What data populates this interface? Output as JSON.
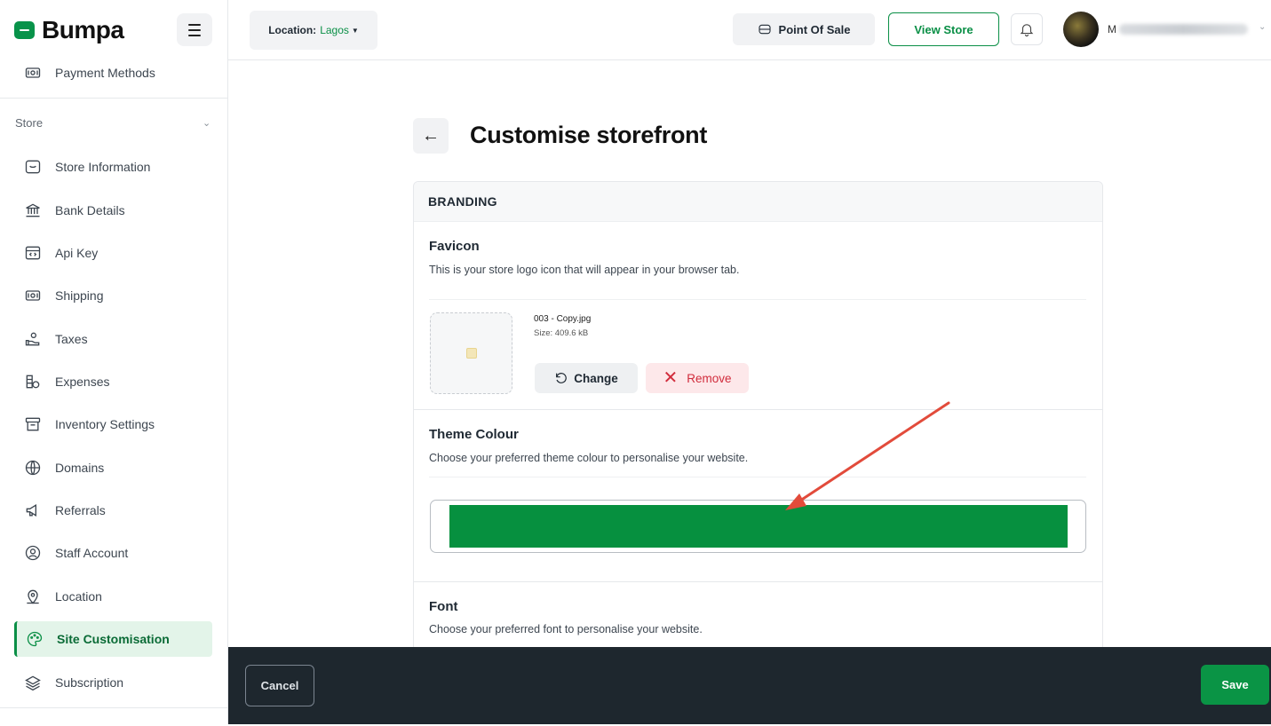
{
  "brand": {
    "name": "Bumpa",
    "color": "#08934a"
  },
  "sidebar": {
    "top_item": {
      "label": "Payment Methods",
      "icon": "cash-icon"
    },
    "section_label": "Store",
    "items": [
      {
        "label": "Store Information",
        "icon": "storefront-icon",
        "active": false
      },
      {
        "label": "Bank Details",
        "icon": "bank-icon",
        "active": false
      },
      {
        "label": "Api Key",
        "icon": "code-icon",
        "active": false
      },
      {
        "label": "Shipping",
        "icon": "cash-icon",
        "active": false
      },
      {
        "label": "Taxes",
        "icon": "hand-coins-icon",
        "active": false
      },
      {
        "label": "Expenses",
        "icon": "coins-icon",
        "active": false
      },
      {
        "label": "Inventory Settings",
        "icon": "archive-box-icon",
        "active": false
      },
      {
        "label": "Domains",
        "icon": "globe-icon",
        "active": false
      },
      {
        "label": "Referrals",
        "icon": "megaphone-icon",
        "active": false
      },
      {
        "label": "Staff Account",
        "icon": "user-circle-icon",
        "active": false
      },
      {
        "label": "Location",
        "icon": "location-user-icon",
        "active": false
      },
      {
        "label": "Site Customisation",
        "icon": "palette-icon",
        "active": true
      },
      {
        "label": "Subscription",
        "icon": "layers-icon",
        "active": false
      }
    ]
  },
  "topbar": {
    "location_label": "Location:",
    "location_value": "Lagos",
    "pos_label": "Point Of Sale",
    "view_store_label": "View Store",
    "user_initial": "M"
  },
  "page": {
    "title": "Customise storefront",
    "section_header": "BRANDING",
    "favicon": {
      "title": "Favicon",
      "description": "This is your store logo icon that will appear in your browser tab.",
      "file_name": "003 - Copy.jpg",
      "file_size": "Size: 409.6 kB",
      "change_label": "Change",
      "remove_label": "Remove"
    },
    "theme": {
      "title": "Theme Colour",
      "description": "Choose your preferred theme colour to personalise your website.",
      "color": "#06903f"
    },
    "font": {
      "title": "Font",
      "description": "Choose your preferred font to personalise your website."
    }
  },
  "footer": {
    "cancel_label": "Cancel",
    "save_label": "Save"
  },
  "colors": {
    "accent": "#0a8f46",
    "danger": "#d12c3c",
    "footer_bg": "#1e272e",
    "annotation_arrow": "#e24b3b"
  }
}
